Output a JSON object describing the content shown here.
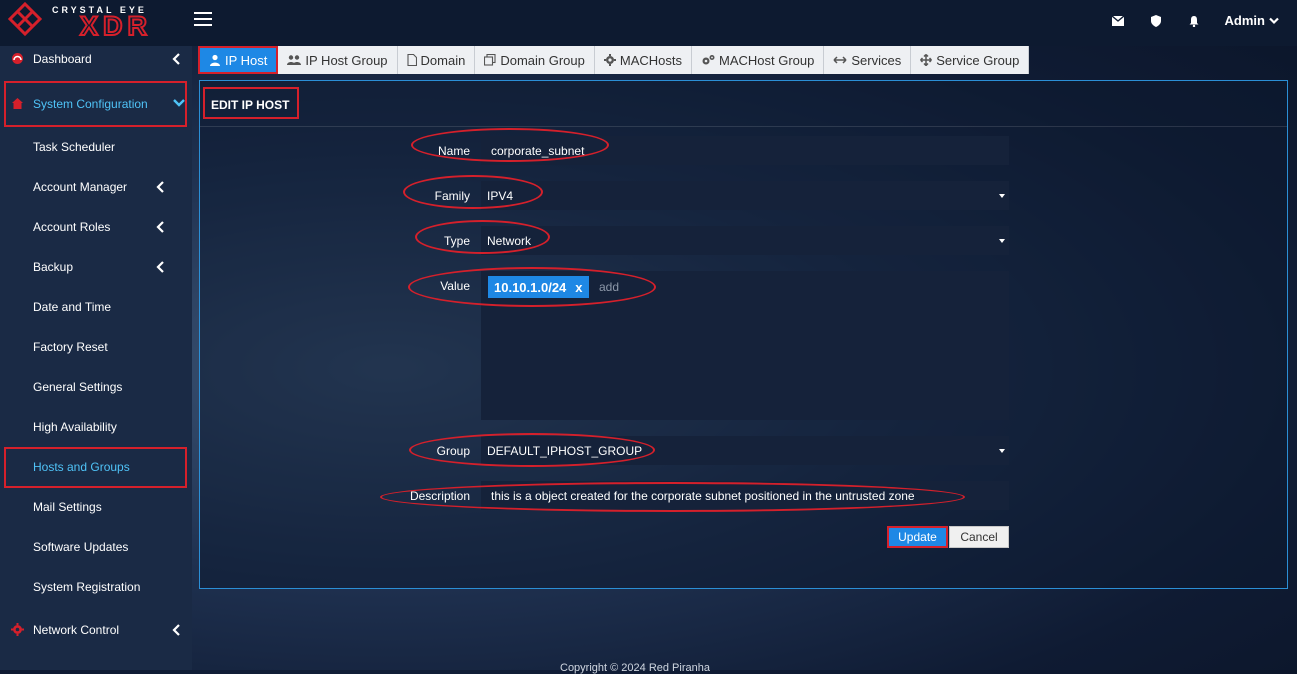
{
  "brand": {
    "tagline": "CRYSTAL EYE",
    "name": "XDR",
    "accent": "#d5202b"
  },
  "header": {
    "user": "Admin",
    "icons": [
      "mail-icon",
      "shield-icon",
      "bell-icon"
    ]
  },
  "sidebar": {
    "items": [
      {
        "label": "Dashboard",
        "icon": "dashboard-icon"
      },
      {
        "label": "System Configuration",
        "icon": "home-icon"
      },
      {
        "label": "Task Scheduler"
      },
      {
        "label": "Account Manager"
      },
      {
        "label": "Account Roles"
      },
      {
        "label": "Backup"
      },
      {
        "label": "Date and Time"
      },
      {
        "label": "Factory Reset"
      },
      {
        "label": "General Settings"
      },
      {
        "label": "High Availability"
      },
      {
        "label": "Hosts and Groups"
      },
      {
        "label": "Mail Settings"
      },
      {
        "label": "Software Updates"
      },
      {
        "label": "System Registration"
      },
      {
        "label": "Network Control",
        "icon": "gear-icon"
      }
    ]
  },
  "tabs": [
    {
      "label": "IP Host",
      "icon": "user-icon",
      "active": true
    },
    {
      "label": "IP Host Group",
      "icon": "users-icon"
    },
    {
      "label": "Domain",
      "icon": "file-icon"
    },
    {
      "label": "Domain Group",
      "icon": "copy-icon"
    },
    {
      "label": "MACHosts",
      "icon": "cog-icon"
    },
    {
      "label": "MACHost Group",
      "icon": "cogs-icon"
    },
    {
      "label": "Services",
      "icon": "arrows-h-icon"
    },
    {
      "label": "Service Group",
      "icon": "arrows-icon"
    }
  ],
  "form": {
    "title": "EDIT IP HOST",
    "name_label": "Name",
    "name_value": "corporate_subnet",
    "family_label": "Family",
    "family_value": "IPV4",
    "type_label": "Type",
    "type_value": "Network",
    "value_label": "Value",
    "value_tag": "10.10.1.0/24",
    "value_tag_remove": "x",
    "value_placeholder": "add",
    "group_label": "Group",
    "group_value": "DEFAULT_IPHOST_GROUP",
    "description_label": "Description",
    "description_value": "this is a object created for the corporate subnet positioned in the untrusted zone",
    "update_label": "Update",
    "cancel_label": "Cancel"
  },
  "footer": {
    "text": "Copyright © 2024 Red Piranha"
  }
}
